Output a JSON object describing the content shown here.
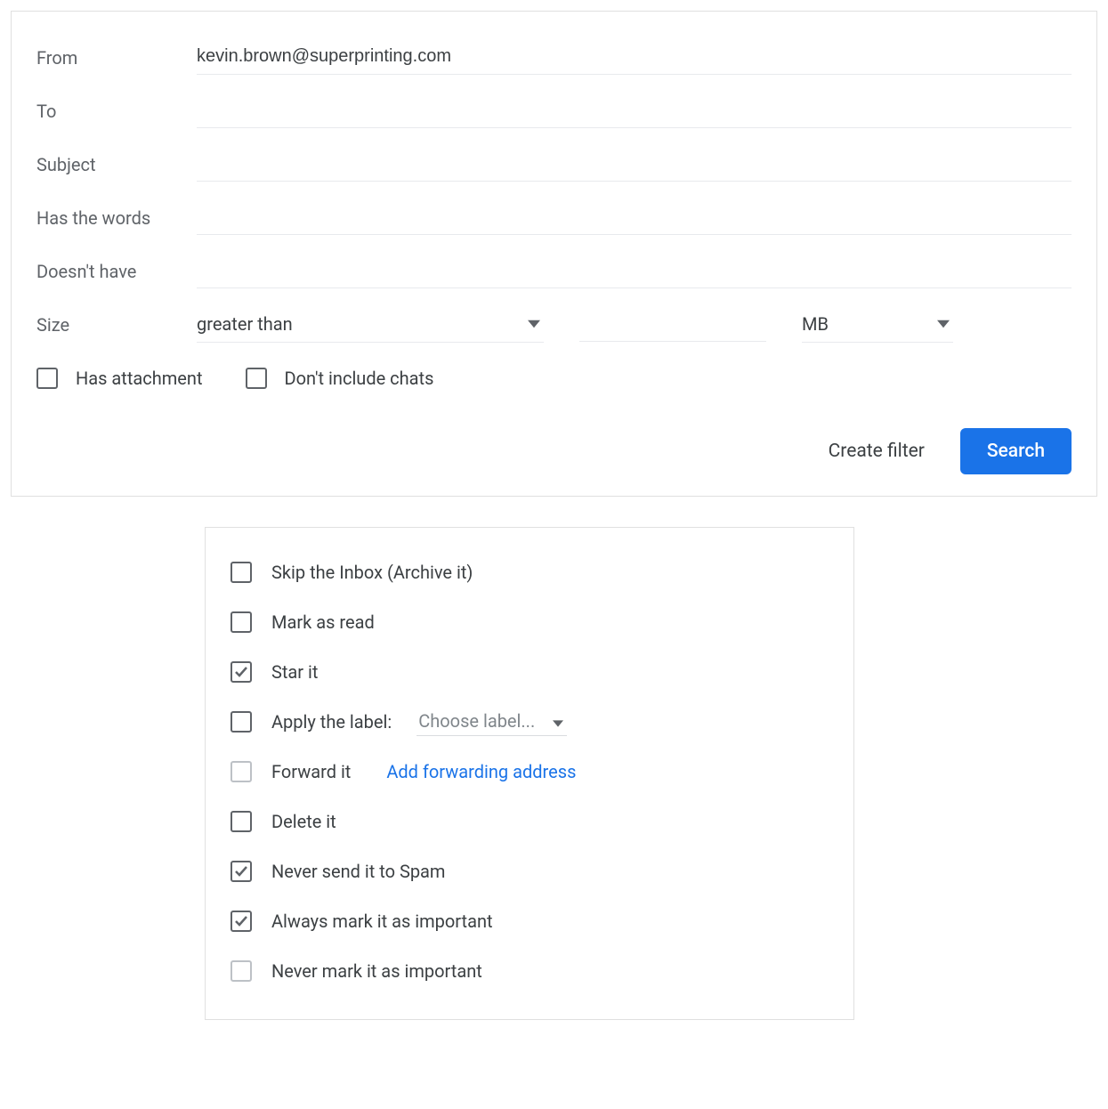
{
  "filter": {
    "labels": {
      "from": "From",
      "to": "To",
      "subject": "Subject",
      "has_words": "Has the words",
      "not_have": "Doesn't have",
      "size": "Size"
    },
    "values": {
      "from": "kevin.brown@superprinting.com",
      "to": "",
      "subject": "",
      "has_words": "",
      "not_have": "",
      "size_cmp": "greater than",
      "size_num": "",
      "size_unit": "MB"
    },
    "checks": {
      "has_attachment": {
        "label": "Has attachment",
        "checked": false
      },
      "no_chats": {
        "label": "Don't include chats",
        "checked": false
      }
    },
    "buttons": {
      "create_filter": "Create filter",
      "search": "Search"
    }
  },
  "actions": {
    "items": [
      {
        "id": "skip-inbox",
        "label": "Skip the Inbox (Archive it)",
        "checked": false,
        "disabled": false
      },
      {
        "id": "mark-read",
        "label": "Mark as read",
        "checked": false,
        "disabled": false
      },
      {
        "id": "star-it",
        "label": "Star it",
        "checked": true,
        "disabled": false
      },
      {
        "id": "apply-label",
        "label": "Apply the label:",
        "checked": false,
        "disabled": false,
        "dropdown": "Choose label..."
      },
      {
        "id": "forward-it",
        "label": "Forward it",
        "checked": false,
        "disabled": true,
        "link": "Add forwarding address"
      },
      {
        "id": "delete-it",
        "label": "Delete it",
        "checked": false,
        "disabled": false
      },
      {
        "id": "never-spam",
        "label": "Never send it to Spam",
        "checked": true,
        "disabled": false
      },
      {
        "id": "always-important",
        "label": "Always mark it as important",
        "checked": true,
        "disabled": false
      },
      {
        "id": "never-important",
        "label": "Never mark it as important",
        "checked": false,
        "disabled": true
      }
    ]
  }
}
